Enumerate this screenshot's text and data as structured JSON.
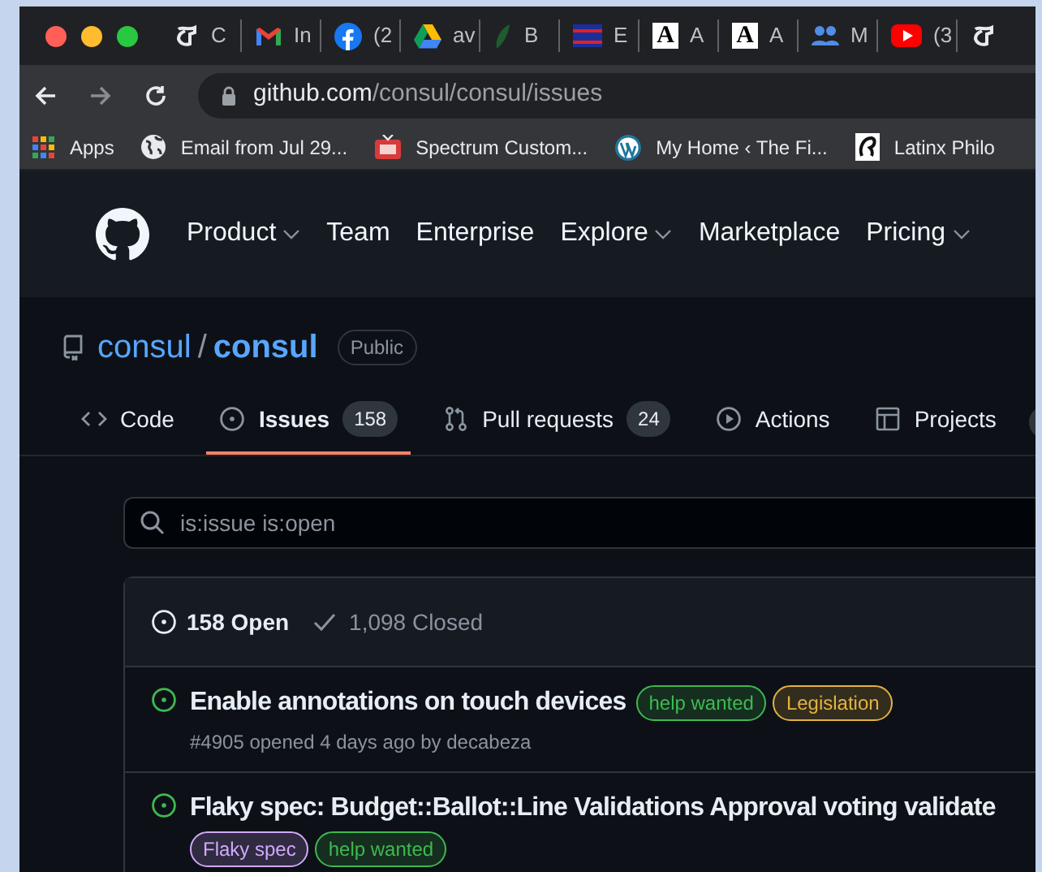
{
  "browser": {
    "tabs": [
      {
        "kind": "nyt",
        "title": "C"
      },
      {
        "kind": "gmail",
        "title": "In"
      },
      {
        "kind": "facebook",
        "title": "(2"
      },
      {
        "kind": "drive",
        "title": "av"
      },
      {
        "kind": "leaf",
        "title": "B"
      },
      {
        "kind": "flag",
        "title": "E"
      },
      {
        "kind": "letter",
        "letter": "A",
        "title": "A"
      },
      {
        "kind": "letter",
        "letter": "A",
        "title": "A"
      },
      {
        "kind": "people",
        "title": "M"
      },
      {
        "kind": "youtube",
        "title": "(3"
      },
      {
        "kind": "nyt"
      }
    ],
    "address": {
      "host": "github.com",
      "path": "/consul/consul/issues"
    },
    "bookmarks": [
      {
        "kind": "apps",
        "label": "Apps"
      },
      {
        "kind": "globe",
        "label": "Email from Jul 29..."
      },
      {
        "kind": "tv",
        "label": "Spectrum Custom..."
      },
      {
        "kind": "wordpress",
        "label": "My Home ‹ The Fi..."
      },
      {
        "kind": "sketch",
        "label": "Latinx Philo"
      }
    ]
  },
  "nav": [
    {
      "label": "Product",
      "dropdown": true
    },
    {
      "label": "Team",
      "dropdown": false
    },
    {
      "label": "Enterprise",
      "dropdown": false
    },
    {
      "label": "Explore",
      "dropdown": true
    },
    {
      "label": "Marketplace",
      "dropdown": false
    },
    {
      "label": "Pricing",
      "dropdown": true
    }
  ],
  "repo": {
    "owner": "consul",
    "separator": "/",
    "name": "consul",
    "visibility": "Public"
  },
  "repo_tabs": [
    {
      "kind": "code",
      "label": "Code",
      "selected": false
    },
    {
      "kind": "issue",
      "label": "Issues",
      "count": "158",
      "selected": true
    },
    {
      "kind": "pull",
      "label": "Pull requests",
      "count": "24",
      "selected": false
    },
    {
      "kind": "play",
      "label": "Actions",
      "selected": false
    },
    {
      "kind": "table",
      "label": "Projects",
      "selected": false
    }
  ],
  "search": {
    "value": "is:issue is:open"
  },
  "issues": {
    "open": "158 Open",
    "closed": "1,098 Closed",
    "items": [
      {
        "title": "Enable annotations on touch devices",
        "labels": [
          {
            "text": "help wanted",
            "color": "#3fb950"
          },
          {
            "text": "Legislation",
            "color": "#e3b341"
          }
        ],
        "meta": "#4905 opened 4 days ago by decabeza"
      },
      {
        "title": "Flaky spec: Budget::Ballot::Line Validations Approval voting validate",
        "labels": [
          {
            "text": "Flaky spec",
            "color": "#d2a8ff"
          },
          {
            "text": "help wanted",
            "color": "#3fb950"
          }
        ]
      }
    ]
  }
}
